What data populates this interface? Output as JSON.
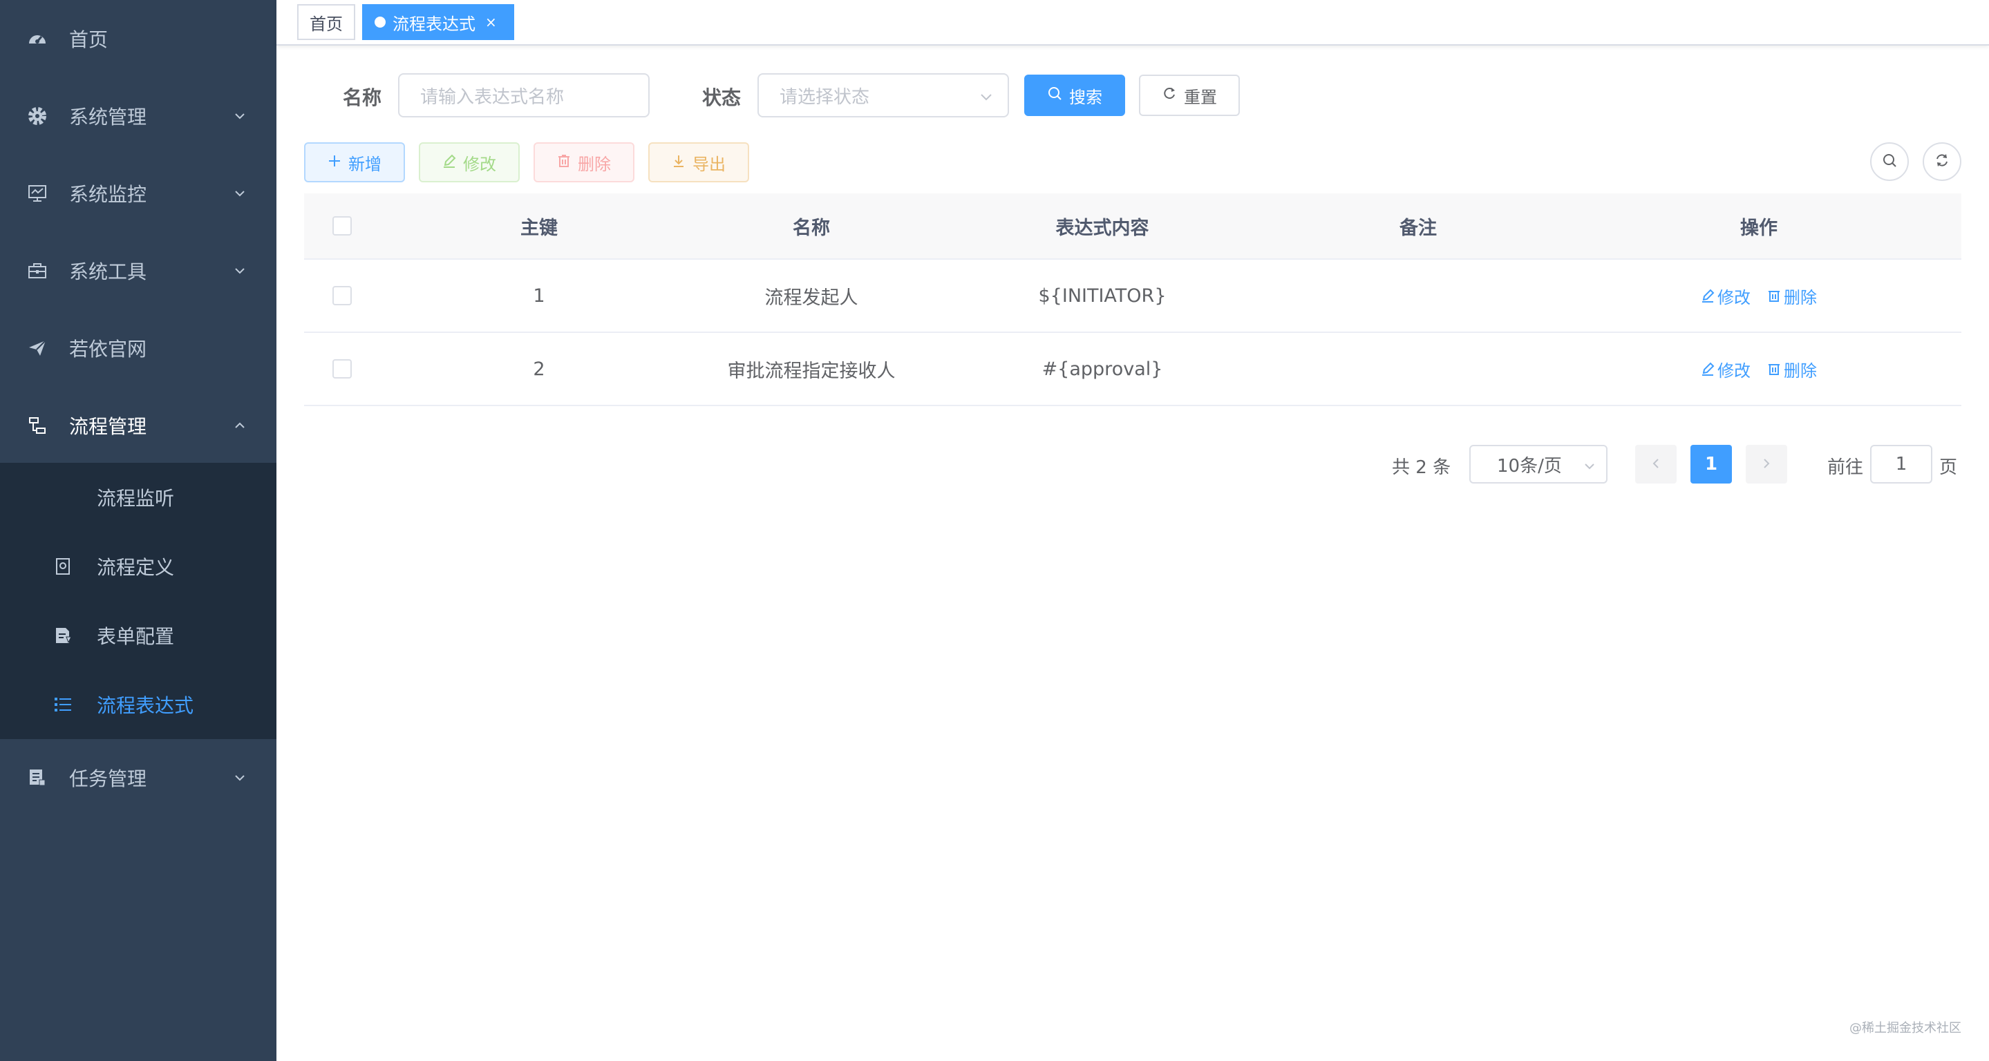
{
  "sidebar": {
    "items": [
      {
        "label": "首页",
        "icon": "dashboard-icon"
      },
      {
        "label": "系统管理",
        "icon": "gear-icon"
      },
      {
        "label": "系统监控",
        "icon": "monitor-icon"
      },
      {
        "label": "系统工具",
        "icon": "toolbox-icon"
      },
      {
        "label": "若依官网",
        "icon": "send-icon"
      },
      {
        "label": "流程管理",
        "icon": "flow-icon"
      },
      {
        "label": "任务管理",
        "icon": "task-icon"
      }
    ],
    "submenu": [
      {
        "label": "流程监听",
        "icon": ""
      },
      {
        "label": "流程定义",
        "icon": "definition-icon"
      },
      {
        "label": "表单配置",
        "icon": "form-icon"
      },
      {
        "label": "流程表达式",
        "icon": "list-icon"
      }
    ]
  },
  "tags": {
    "home": "首页",
    "active": "流程表达式",
    "close": "×"
  },
  "query": {
    "name_label": "名称",
    "name_placeholder": "请输入表达式名称",
    "status_label": "状态",
    "status_placeholder": "请选择状态",
    "search_label": "搜索",
    "reset_label": "重置"
  },
  "toolbar": {
    "add_label": "新增",
    "edit_label": "修改",
    "delete_label": "删除",
    "export_label": "导出"
  },
  "table": {
    "columns": [
      "主键",
      "名称",
      "表达式内容",
      "备注",
      "操作"
    ],
    "rows": [
      {
        "id": "1",
        "name": "流程发起人",
        "expression": "${INITIATOR}",
        "remark": "",
        "edit": "修改",
        "delete": "删除"
      },
      {
        "id": "2",
        "name": "审批流程指定接收人",
        "expression": "#{approval}",
        "remark": "",
        "edit": "修改",
        "delete": "删除"
      }
    ]
  },
  "pagination": {
    "total_text": "共 2 条",
    "page_size": "10条/页",
    "current_page": "1",
    "goto_label": "前往",
    "goto_value": "1",
    "page_suffix": "页"
  },
  "watermark": "@稀土掘金技术社区",
  "colors": {
    "sidebar_bg": "#304156",
    "submenu_bg": "#1f2d3d",
    "primary": "#409eff",
    "success": "#67c23a",
    "danger": "#f56c6c",
    "warning": "#e6a23c"
  }
}
